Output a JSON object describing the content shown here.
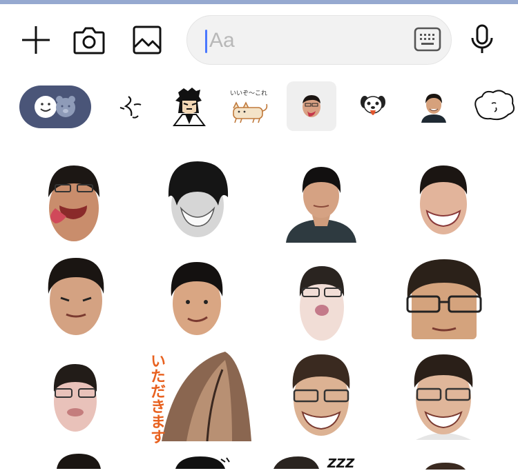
{
  "composer": {
    "placeholder": "Aa",
    "add_icon": "plus-icon",
    "camera_icon": "camera-icon",
    "image_icon": "image-icon",
    "keyboard_icon": "keyboard-icon",
    "mic_icon": "microphone-icon"
  },
  "sticker_tabs": [
    {
      "name": "emoji-and-bear",
      "selected": false
    },
    {
      "name": "doodle-face",
      "selected": false
    },
    {
      "name": "manga-character",
      "selected": false
    },
    {
      "name": "cat-sticker",
      "label": "いいぞ〜これ",
      "selected": false
    },
    {
      "name": "tongue-face",
      "selected": true
    },
    {
      "name": "dog-face",
      "selected": false
    },
    {
      "name": "smiling-man",
      "selected": false
    },
    {
      "name": "cloud-blob",
      "selected": false
    }
  ],
  "stickers": [
    {
      "name": "tongue-out-face"
    },
    {
      "name": "shadowed-hair-face"
    },
    {
      "name": "portrait-photo"
    },
    {
      "name": "big-grin-face"
    },
    {
      "name": "squinting-face"
    },
    {
      "name": "smirking-face"
    },
    {
      "name": "pursed-lips-face"
    },
    {
      "name": "glasses-close-up-face"
    },
    {
      "name": "glasses-face"
    },
    {
      "name": "itadakimasu-sticker",
      "text": "いただきます"
    },
    {
      "name": "wide-grin-glasses-face"
    },
    {
      "name": "toothy-grin-glasses-face"
    }
  ],
  "partial_row": {
    "sleep_text": "ZZZ"
  },
  "colors": {
    "accent_bar": "#96a9d0",
    "caret": "#4a78ff",
    "emoji_pill": "#4a5578",
    "itadakimasu": "#e8611f"
  }
}
